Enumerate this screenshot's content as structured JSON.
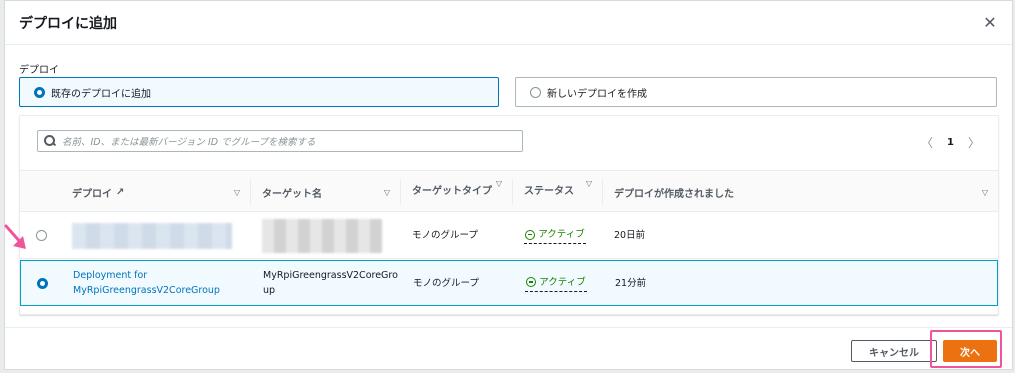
{
  "dialog": {
    "title": "デプロイに追加",
    "close_symbol": "✕"
  },
  "deploy_section": {
    "label": "デプロイ",
    "options": [
      {
        "label": "既存のデプロイに追加",
        "selected": true
      },
      {
        "label": "新しいデプロイを作成",
        "selected": false
      }
    ]
  },
  "search": {
    "placeholder": "名前、ID、または最新バージョン ID でグループを検索する"
  },
  "pagination": {
    "prev": "〈",
    "page": "1",
    "next": "〉"
  },
  "table": {
    "columns": [
      {
        "label": "デプロイ",
        "external": true
      },
      {
        "label": "ターゲット名"
      },
      {
        "label": "ターゲットタイプ"
      },
      {
        "label": "ステータス"
      },
      {
        "label": "デプロイが作成されました"
      }
    ],
    "sort_symbol": "▽",
    "external_symbol": "↗",
    "rows": [
      {
        "selected": false,
        "deployment": "",
        "target_name": "",
        "target_type": "モノのグループ",
        "status": "アクティブ",
        "created": "20日前"
      },
      {
        "selected": true,
        "deployment": "Deployment for MyRpiGreengrassV2CoreGroup",
        "target_name": "MyRpiGreengrassV2CoreGroup",
        "target_type": "モノのグループ",
        "status": "アクティブ",
        "created": "21分前"
      }
    ]
  },
  "footer": {
    "cancel_label": "キャンセル",
    "next_label": "次へ"
  },
  "colors": {
    "primary_button": "#ec7211",
    "link": "#0073bb",
    "status_ok": "#1d8102",
    "annotation": "#f0559a"
  }
}
